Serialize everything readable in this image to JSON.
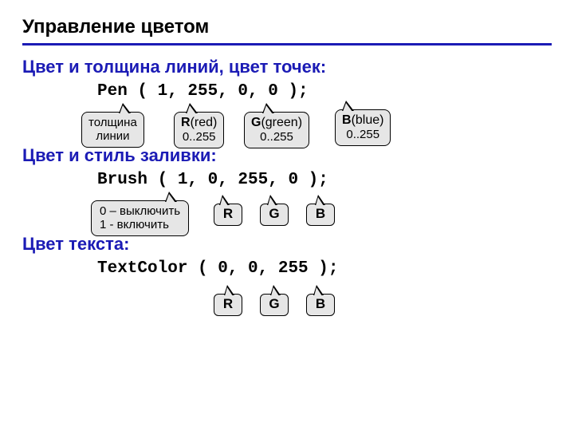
{
  "title": "Управление цветом",
  "section1": {
    "heading": "Цвет и толщина линий, цвет точек:",
    "code": "Pen ( 1, 255, 0, 0 );",
    "callouts": {
      "thickness_l1": "толщина",
      "thickness_l2": "линии",
      "r_l1_b": "R",
      "r_l1_rest": "(red)",
      "r_l2": "0..255",
      "g_l1_b": "G",
      "g_l1_rest": "(green)",
      "g_l2": "0..255",
      "b_l1_b": "B",
      "b_l1_rest": "(blue)",
      "b_l2": "0..255"
    }
  },
  "section2": {
    "heading": "Цвет и стиль заливки:",
    "code": "Brush ( 1, 0, 255, 0 );",
    "callouts": {
      "mode_l1": "0 – выключить",
      "mode_l2": "1 - включить",
      "r": "R",
      "g": "G",
      "b": "B"
    }
  },
  "section3": {
    "heading": "Цвет текста:",
    "code": "TextColor ( 0, 0, 255 );",
    "callouts": {
      "r": "R",
      "g": "G",
      "b": "B"
    }
  }
}
